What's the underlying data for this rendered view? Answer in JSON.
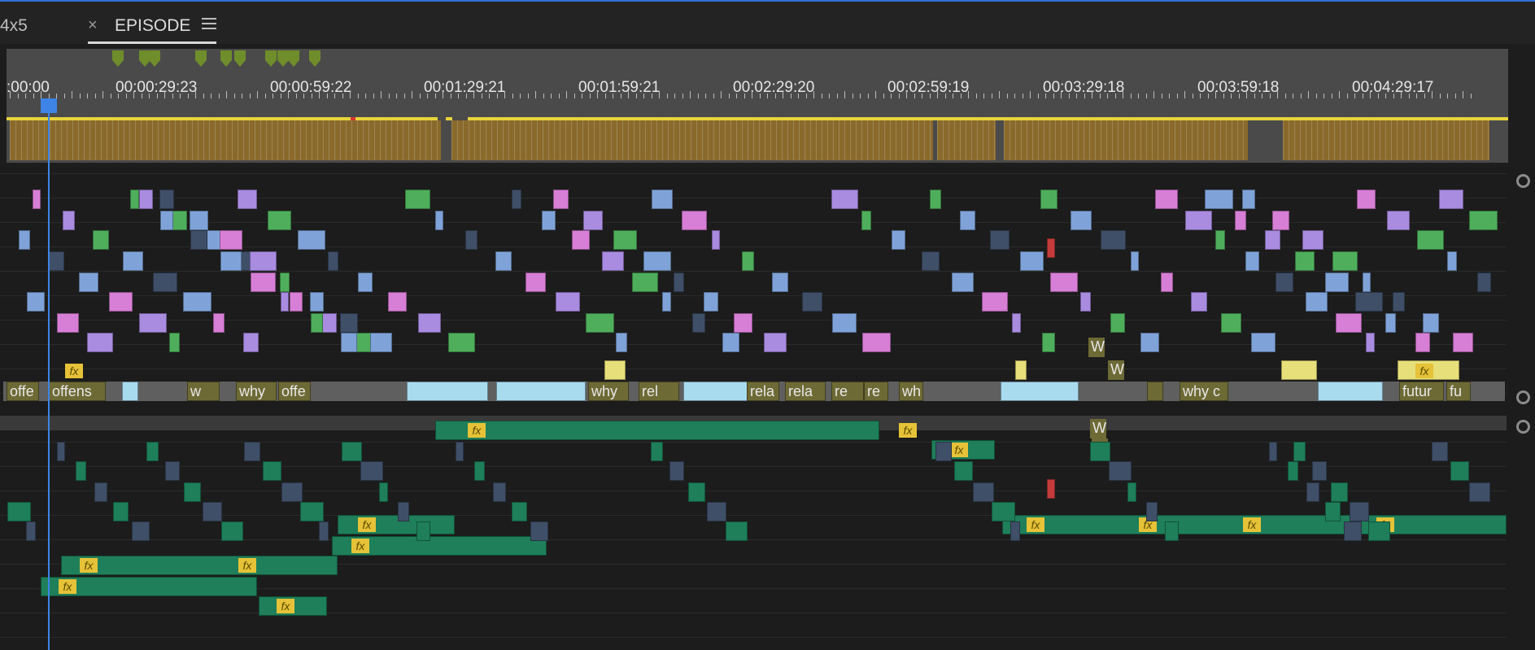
{
  "tabs": {
    "left_tab_partial": "4x5",
    "active_tab": {
      "close_glyph": "×",
      "label": "EPISODE",
      "menu_icon": "hamburger-menu-icon"
    }
  },
  "ruler": {
    "timecodes": [
      "00:00:29:23",
      "00:00:59:22",
      "00:01:29:21",
      "00:01:59:21",
      "00:02:29:20",
      "00:02:59:19",
      "00:03:29:18",
      "00:03:59:18",
      "00:04:29:17"
    ],
    "start_timecode_partial": ":00:00"
  },
  "clip_labels": {
    "v_offe_1": "offe",
    "v_offens": "offens",
    "v_w1": "w",
    "v_why1": "why",
    "v_offe_2": "offe",
    "v_why2": "why",
    "v_rel1": "rel",
    "v_rela1": "rela",
    "v_rela2": "rela",
    "v_re1": "re",
    "v_re2": "re",
    "v_wh": "wh",
    "v_whyc": "why c",
    "v_futur": "futur",
    "v_fu": "fu",
    "v_w2": "W",
    "v_w3": "W",
    "v_w4": "W",
    "v_w5": "W"
  },
  "effects_badge": "fx",
  "colors": {
    "accent": "#2f6fd6",
    "playhead": "#3d84e6",
    "clip_blue": "#7fa3d8",
    "clip_pink": "#d77ed6",
    "clip_purple": "#a98be0",
    "clip_green": "#4fae5b",
    "clip_teal": "#1e7f5a",
    "clip_olive": "#6d6a35",
    "clip_lightblue": "#a9dbef",
    "clip_yellow": "#e7df7a",
    "clip_slate": "#3f4f68",
    "fx_badge": "#e6c238",
    "marker_green": "#6f8d2b",
    "ruler_yellow": "#e7d43a",
    "clip_strip_brown": "#8a6a2c"
  }
}
